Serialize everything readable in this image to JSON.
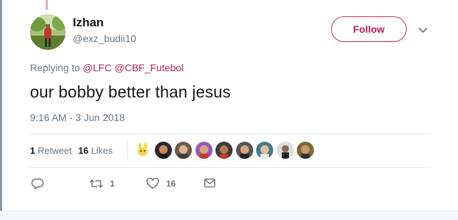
{
  "author": {
    "display_name": "Izhan",
    "handle": "@exz_budii10"
  },
  "follow_label": "Follow",
  "reply_prefix": "Replying to",
  "reply_mentions": [
    "@LFC",
    "@CBF_Futebol"
  ],
  "tweet_text": "our bobby better than jesus",
  "timestamp": "9:16 AM - 3 Jun 2018",
  "stats": {
    "retweets": "1",
    "retweets_label": "Retweet",
    "likes": "16",
    "likes_label": "Likes"
  },
  "actions": {
    "reply_count": "",
    "retweet_count": "1",
    "like_count": "16"
  },
  "colors": {
    "accent": "#b51f57",
    "muted": "#657786",
    "divider": "#e6ecf0"
  },
  "icons": [
    "caret-down-icon",
    "reply-icon",
    "retweet-icon",
    "heart-icon",
    "message-icon"
  ]
}
